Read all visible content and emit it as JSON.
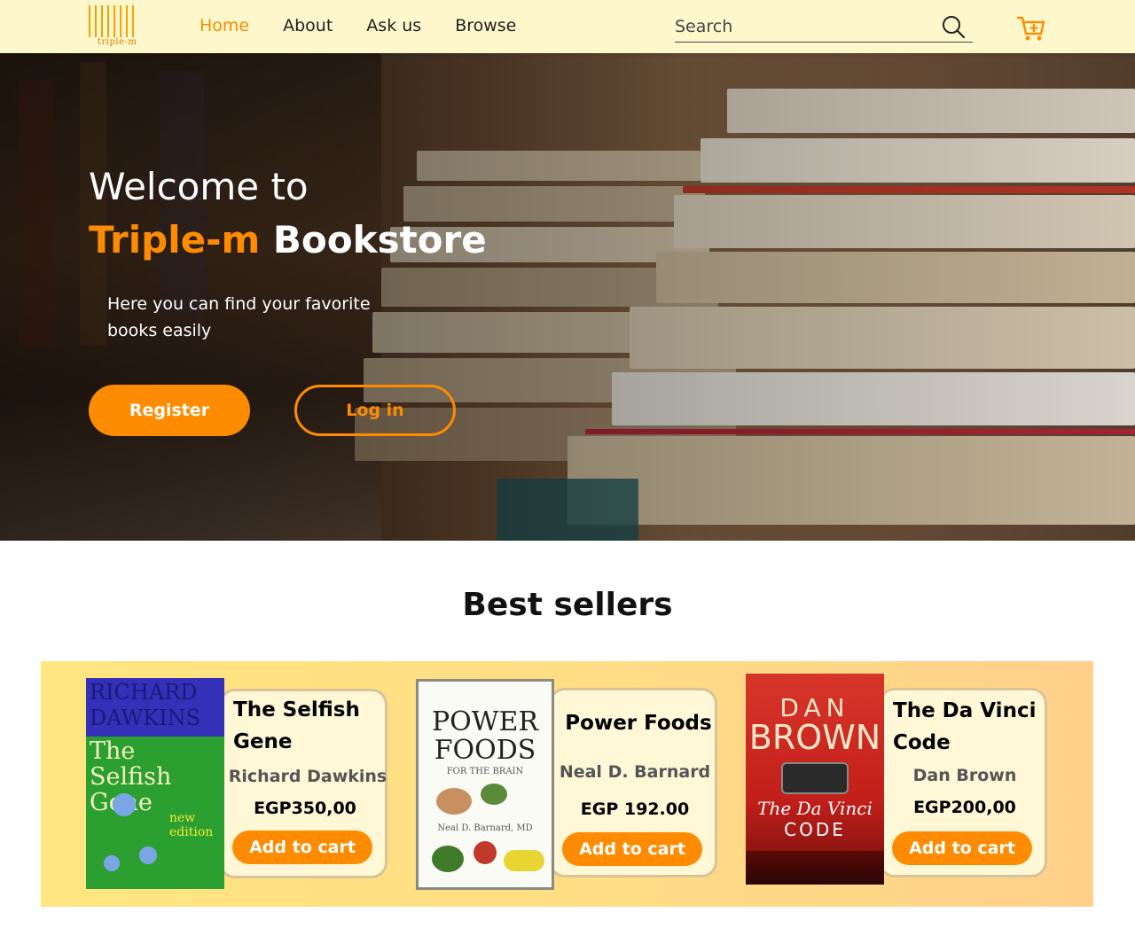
{
  "header": {
    "logo_text": "triple-m",
    "nav": [
      {
        "label": "Home",
        "active": true
      },
      {
        "label": "About",
        "active": false
      },
      {
        "label": "Ask us",
        "active": false
      },
      {
        "label": "Browse",
        "active": false
      }
    ],
    "search_placeholder": "Search",
    "icons": {
      "search": "search-icon",
      "cart": "cart-plus-icon"
    }
  },
  "hero": {
    "title_line1": "Welcome to",
    "brand": "Triple-m",
    "title_line2_rest": " Bookstore",
    "subtitle": "Here you can find your favorite books easily",
    "register_label": "Register",
    "login_label": "Log in"
  },
  "best_sellers": {
    "heading": "Best sellers",
    "books": [
      {
        "title": "The Selfish Gene",
        "author": "Richard Dawkins",
        "price": "EGP350,00",
        "button": "Add to cart",
        "cover": {
          "top": "RICHARD DAWKINS",
          "main": "The Selfish Gene",
          "badge": "new edition"
        }
      },
      {
        "title": "Power Foods",
        "author": "Neal D. Barnard",
        "price": "EGP 192.00",
        "button": "Add to cart",
        "cover": {
          "top": "POWER",
          "main": "FOODS",
          "sub": "FOR THE BRAIN",
          "author": "Neal D. Barnard, MD"
        }
      },
      {
        "title": "The Da Vinci Code",
        "author": "Dan Brown",
        "price": "EGP200,00",
        "button": "Add to cart",
        "cover": {
          "top": "DAN",
          "main": "BROWN",
          "sub": "The Da Vinci",
          "code": "CODE"
        }
      }
    ]
  },
  "colors": {
    "accent": "#ff8c00",
    "header_bg": "#fff7cc",
    "card_bg": "#fff7d6"
  }
}
